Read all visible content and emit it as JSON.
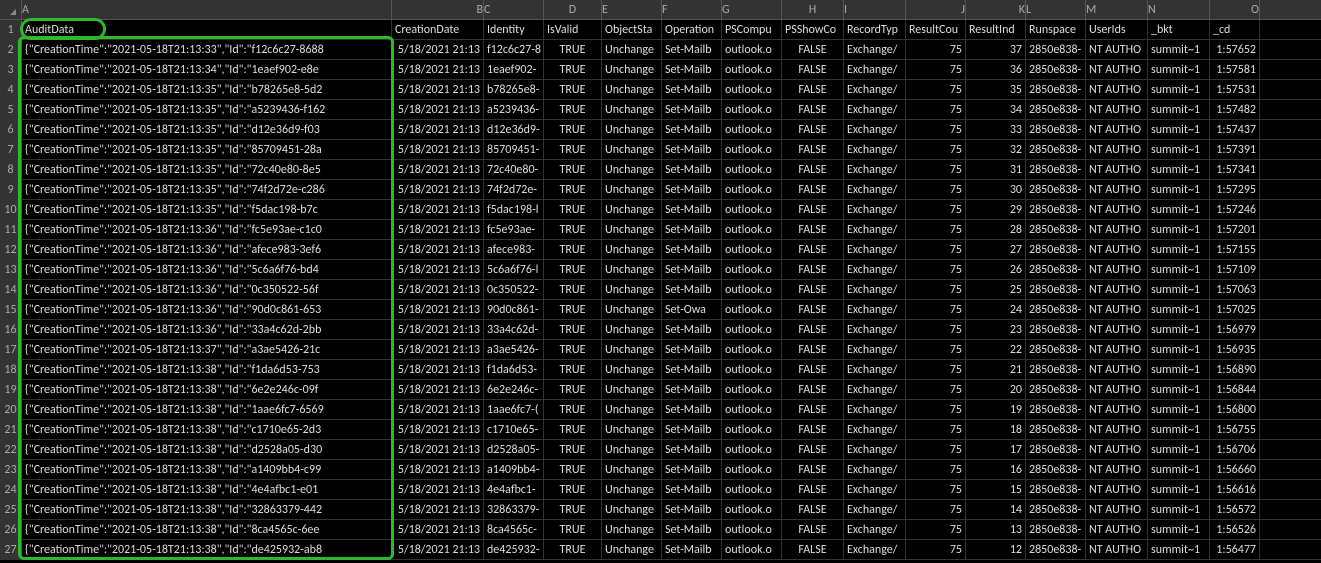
{
  "columns": [
    "A",
    "B",
    "C",
    "D",
    "E",
    "F",
    "G",
    "H",
    "I",
    "J",
    "K",
    "L",
    "M",
    "N",
    "O"
  ],
  "headerRow": {
    "A": "AuditData",
    "B": "CreationDate",
    "C": "Identity",
    "D": "IsValid",
    "E": "ObjectSta",
    "F": "Operation",
    "G": "PSCompu",
    "H": "PSShowCo",
    "I": "RecordTyp",
    "J": "ResultCou",
    "K": "ResultInd",
    "L": "Runspace",
    "M": "UserIds",
    "N": "_bkt",
    "O": "_cd"
  },
  "chart_data": {
    "type": "table",
    "title": "AuditData spreadsheet",
    "rows": [
      {
        "n": 2,
        "A": "{\"CreationTime\":\"2021-05-18T21:13:33\",\"Id\":\"f12c6c27-8688",
        "B": "5/18/2021 21:13",
        "C": "f12c6c27-8",
        "D": "TRUE",
        "E": "Unchange",
        "F": "Set-Mailb",
        "G": "outlook.o",
        "H": "FALSE",
        "I": "Exchange/",
        "J": "75",
        "K": "37",
        "L": "2850e838-",
        "M": "NT AUTHO",
        "N": "summit~1",
        "O": "1:57652"
      },
      {
        "n": 3,
        "A": "{\"CreationTime\":\"2021-05-18T21:13:34\",\"Id\":\"1eaef902-e8e",
        "B": "5/18/2021 21:13",
        "C": "1eaef902-",
        "D": "TRUE",
        "E": "Unchange",
        "F": "Set-Mailb",
        "G": "outlook.o",
        "H": "FALSE",
        "I": "Exchange/",
        "J": "75",
        "K": "36",
        "L": "2850e838-",
        "M": "NT AUTHO",
        "N": "summit~1",
        "O": "1:57581"
      },
      {
        "n": 4,
        "A": "{\"CreationTime\":\"2021-05-18T21:13:35\",\"Id\":\"b78265e8-5d2",
        "B": "5/18/2021 21:13",
        "C": "b78265e8-",
        "D": "TRUE",
        "E": "Unchange",
        "F": "Set-Mailb",
        "G": "outlook.o",
        "H": "FALSE",
        "I": "Exchange/",
        "J": "75",
        "K": "35",
        "L": "2850e838-",
        "M": "NT AUTHO",
        "N": "summit~1",
        "O": "1:57531"
      },
      {
        "n": 5,
        "A": "{\"CreationTime\":\"2021-05-18T21:13:35\",\"Id\":\"a5239436-f162",
        "B": "5/18/2021 21:13",
        "C": "a5239436-",
        "D": "TRUE",
        "E": "Unchange",
        "F": "Set-Mailb",
        "G": "outlook.o",
        "H": "FALSE",
        "I": "Exchange/",
        "J": "75",
        "K": "34",
        "L": "2850e838-",
        "M": "NT AUTHO",
        "N": "summit~1",
        "O": "1:57482"
      },
      {
        "n": 6,
        "A": "{\"CreationTime\":\"2021-05-18T21:13:35\",\"Id\":\"d12e36d9-f03",
        "B": "5/18/2021 21:13",
        "C": "d12e36d9-",
        "D": "TRUE",
        "E": "Unchange",
        "F": "Set-Mailb",
        "G": "outlook.o",
        "H": "FALSE",
        "I": "Exchange/",
        "J": "75",
        "K": "33",
        "L": "2850e838-",
        "M": "NT AUTHO",
        "N": "summit~1",
        "O": "1:57437"
      },
      {
        "n": 7,
        "A": "{\"CreationTime\":\"2021-05-18T21:13:35\",\"Id\":\"85709451-28a",
        "B": "5/18/2021 21:13",
        "C": "85709451-",
        "D": "TRUE",
        "E": "Unchange",
        "F": "Set-Mailb",
        "G": "outlook.o",
        "H": "FALSE",
        "I": "Exchange/",
        "J": "75",
        "K": "32",
        "L": "2850e838-",
        "M": "NT AUTHO",
        "N": "summit~1",
        "O": "1:57391"
      },
      {
        "n": 8,
        "A": "{\"CreationTime\":\"2021-05-18T21:13:35\",\"Id\":\"72c40e80-8e5",
        "B": "5/18/2021 21:13",
        "C": "72c40e80-",
        "D": "TRUE",
        "E": "Unchange",
        "F": "Set-Mailb",
        "G": "outlook.o",
        "H": "FALSE",
        "I": "Exchange/",
        "J": "75",
        "K": "31",
        "L": "2850e838-",
        "M": "NT AUTHO",
        "N": "summit~1",
        "O": "1:57341"
      },
      {
        "n": 9,
        "A": "{\"CreationTime\":\"2021-05-18T21:13:35\",\"Id\":\"74f2d72e-c286",
        "B": "5/18/2021 21:13",
        "C": "74f2d72e-",
        "D": "TRUE",
        "E": "Unchange",
        "F": "Set-Mailb",
        "G": "outlook.o",
        "H": "FALSE",
        "I": "Exchange/",
        "J": "75",
        "K": "30",
        "L": "2850e838-",
        "M": "NT AUTHO",
        "N": "summit~1",
        "O": "1:57295"
      },
      {
        "n": 10,
        "A": "{\"CreationTime\":\"2021-05-18T21:13:35\",\"Id\":\"f5dac198-b7c",
        "B": "5/18/2021 21:13",
        "C": "f5dac198-l",
        "D": "TRUE",
        "E": "Unchange",
        "F": "Set-Mailb",
        "G": "outlook.o",
        "H": "FALSE",
        "I": "Exchange/",
        "J": "75",
        "K": "29",
        "L": "2850e838-",
        "M": "NT AUTHO",
        "N": "summit~1",
        "O": "1:57246"
      },
      {
        "n": 11,
        "A": "{\"CreationTime\":\"2021-05-18T21:13:36\",\"Id\":\"fc5e93ae-c1c0",
        "B": "5/18/2021 21:13",
        "C": "fc5e93ae-",
        "D": "TRUE",
        "E": "Unchange",
        "F": "Set-Mailb",
        "G": "outlook.o",
        "H": "FALSE",
        "I": "Exchange/",
        "J": "75",
        "K": "28",
        "L": "2850e838-",
        "M": "NT AUTHO",
        "N": "summit~1",
        "O": "1:57201"
      },
      {
        "n": 12,
        "A": "{\"CreationTime\":\"2021-05-18T21:13:36\",\"Id\":\"afece983-3ef6",
        "B": "5/18/2021 21:13",
        "C": "afece983-",
        "D": "TRUE",
        "E": "Unchange",
        "F": "Set-Mailb",
        "G": "outlook.o",
        "H": "FALSE",
        "I": "Exchange/",
        "J": "75",
        "K": "27",
        "L": "2850e838-",
        "M": "NT AUTHO",
        "N": "summit~1",
        "O": "1:57155"
      },
      {
        "n": 13,
        "A": "{\"CreationTime\":\"2021-05-18T21:13:36\",\"Id\":\"5c6a6f76-bd4",
        "B": "5/18/2021 21:13",
        "C": "5c6a6f76-l",
        "D": "TRUE",
        "E": "Unchange",
        "F": "Set-Mailb",
        "G": "outlook.o",
        "H": "FALSE",
        "I": "Exchange/",
        "J": "75",
        "K": "26",
        "L": "2850e838-",
        "M": "NT AUTHO",
        "N": "summit~1",
        "O": "1:57109"
      },
      {
        "n": 14,
        "A": "{\"CreationTime\":\"2021-05-18T21:13:36\",\"Id\":\"0c350522-56f",
        "B": "5/18/2021 21:13",
        "C": "0c350522-",
        "D": "TRUE",
        "E": "Unchange",
        "F": "Set-Mailb",
        "G": "outlook.o",
        "H": "FALSE",
        "I": "Exchange/",
        "J": "75",
        "K": "25",
        "L": "2850e838-",
        "M": "NT AUTHO",
        "N": "summit~1",
        "O": "1:57063"
      },
      {
        "n": 15,
        "A": "{\"CreationTime\":\"2021-05-18T21:13:36\",\"Id\":\"90d0c861-653",
        "B": "5/18/2021 21:13",
        "C": "90d0c861-",
        "D": "TRUE",
        "E": "Unchange",
        "F": "Set-Owa",
        "G": "outlook.o",
        "H": "FALSE",
        "I": "Exchange/",
        "J": "75",
        "K": "24",
        "L": "2850e838-",
        "M": "NT AUTHO",
        "N": "summit~1",
        "O": "1:57025"
      },
      {
        "n": 16,
        "A": "{\"CreationTime\":\"2021-05-18T21:13:36\",\"Id\":\"33a4c62d-2bb",
        "B": "5/18/2021 21:13",
        "C": "33a4c62d-",
        "D": "TRUE",
        "E": "Unchange",
        "F": "Set-Mailb",
        "G": "outlook.o",
        "H": "FALSE",
        "I": "Exchange/",
        "J": "75",
        "K": "23",
        "L": "2850e838-",
        "M": "NT AUTHO",
        "N": "summit~1",
        "O": "1:56979"
      },
      {
        "n": 17,
        "A": "{\"CreationTime\":\"2021-05-18T21:13:37\",\"Id\":\"a3ae5426-21c",
        "B": "5/18/2021 21:13",
        "C": "a3ae5426-",
        "D": "TRUE",
        "E": "Unchange",
        "F": "Set-Mailb",
        "G": "outlook.o",
        "H": "FALSE",
        "I": "Exchange/",
        "J": "75",
        "K": "22",
        "L": "2850e838-",
        "M": "NT AUTHO",
        "N": "summit~1",
        "O": "1:56935"
      },
      {
        "n": 18,
        "A": "{\"CreationTime\":\"2021-05-18T21:13:38\",\"Id\":\"f1da6d53-753",
        "B": "5/18/2021 21:13",
        "C": "f1da6d53-",
        "D": "TRUE",
        "E": "Unchange",
        "F": "Set-Mailb",
        "G": "outlook.o",
        "H": "FALSE",
        "I": "Exchange/",
        "J": "75",
        "K": "21",
        "L": "2850e838-",
        "M": "NT AUTHO",
        "N": "summit~1",
        "O": "1:56890"
      },
      {
        "n": 19,
        "A": "{\"CreationTime\":\"2021-05-18T21:13:38\",\"Id\":\"6e2e246c-09f",
        "B": "5/18/2021 21:13",
        "C": "6e2e246c-",
        "D": "TRUE",
        "E": "Unchange",
        "F": "Set-Mailb",
        "G": "outlook.o",
        "H": "FALSE",
        "I": "Exchange/",
        "J": "75",
        "K": "20",
        "L": "2850e838-",
        "M": "NT AUTHO",
        "N": "summit~1",
        "O": "1:56844"
      },
      {
        "n": 20,
        "A": "{\"CreationTime\":\"2021-05-18T21:13:38\",\"Id\":\"1aae6fc7-6569",
        "B": "5/18/2021 21:13",
        "C": "1aae6fc7-(",
        "D": "TRUE",
        "E": "Unchange",
        "F": "Set-Mailb",
        "G": "outlook.o",
        "H": "FALSE",
        "I": "Exchange/",
        "J": "75",
        "K": "19",
        "L": "2850e838-",
        "M": "NT AUTHO",
        "N": "summit~1",
        "O": "1:56800"
      },
      {
        "n": 21,
        "A": "{\"CreationTime\":\"2021-05-18T21:13:38\",\"Id\":\"c1710e65-2d3",
        "B": "5/18/2021 21:13",
        "C": "c1710e65-",
        "D": "TRUE",
        "E": "Unchange",
        "F": "Set-Mailb",
        "G": "outlook.o",
        "H": "FALSE",
        "I": "Exchange/",
        "J": "75",
        "K": "18",
        "L": "2850e838-",
        "M": "NT AUTHO",
        "N": "summit~1",
        "O": "1:56755"
      },
      {
        "n": 22,
        "A": "{\"CreationTime\":\"2021-05-18T21:13:38\",\"Id\":\"d2528a05-d30",
        "B": "5/18/2021 21:13",
        "C": "d2528a05-",
        "D": "TRUE",
        "E": "Unchange",
        "F": "Set-Mailb",
        "G": "outlook.o",
        "H": "FALSE",
        "I": "Exchange/",
        "J": "75",
        "K": "17",
        "L": "2850e838-",
        "M": "NT AUTHO",
        "N": "summit~1",
        "O": "1:56706"
      },
      {
        "n": 23,
        "A": "{\"CreationTime\":\"2021-05-18T21:13:38\",\"Id\":\"a1409bb4-c99",
        "B": "5/18/2021 21:13",
        "C": "a1409bb4-",
        "D": "TRUE",
        "E": "Unchange",
        "F": "Set-Mailb",
        "G": "outlook.o",
        "H": "FALSE",
        "I": "Exchange/",
        "J": "75",
        "K": "16",
        "L": "2850e838-",
        "M": "NT AUTHO",
        "N": "summit~1",
        "O": "1:56660"
      },
      {
        "n": 24,
        "A": "{\"CreationTime\":\"2021-05-18T21:13:38\",\"Id\":\"4e4afbc1-e01",
        "B": "5/18/2021 21:13",
        "C": "4e4afbc1-",
        "D": "TRUE",
        "E": "Unchange",
        "F": "Set-Mailb",
        "G": "outlook.o",
        "H": "FALSE",
        "I": "Exchange/",
        "J": "75",
        "K": "15",
        "L": "2850e838-",
        "M": "NT AUTHO",
        "N": "summit~1",
        "O": "1:56616"
      },
      {
        "n": 25,
        "A": "{\"CreationTime\":\"2021-05-18T21:13:38\",\"Id\":\"32863379-442",
        "B": "5/18/2021 21:13",
        "C": "32863379-",
        "D": "TRUE",
        "E": "Unchange",
        "F": "Set-Mailb",
        "G": "outlook.o",
        "H": "FALSE",
        "I": "Exchange/",
        "J": "75",
        "K": "14",
        "L": "2850e838-",
        "M": "NT AUTHO",
        "N": "summit~1",
        "O": "1:56572"
      },
      {
        "n": 26,
        "A": "{\"CreationTime\":\"2021-05-18T21:13:38\",\"Id\":\"8ca4565c-6ee",
        "B": "5/18/2021 21:13",
        "C": "8ca4565c-",
        "D": "TRUE",
        "E": "Unchange",
        "F": "Set-Mailb",
        "G": "outlook.o",
        "H": "FALSE",
        "I": "Exchange/",
        "J": "75",
        "K": "13",
        "L": "2850e838-",
        "M": "NT AUTHO",
        "N": "summit~1",
        "O": "1:56526"
      },
      {
        "n": 27,
        "A": "{\"CreationTime\":\"2021-05-18T21:13:38\",\"Id\":\"de425932-ab8",
        "B": "5/18/2021 21:13",
        "C": "de425932-",
        "D": "TRUE",
        "E": "Unchange",
        "F": "Set-Mailb",
        "G": "outlook.o",
        "H": "FALSE",
        "I": "Exchange/",
        "J": "75",
        "K": "12",
        "L": "2850e838-",
        "M": "NT AUTHO",
        "N": "summit~1",
        "O": "1:56477"
      }
    ]
  }
}
